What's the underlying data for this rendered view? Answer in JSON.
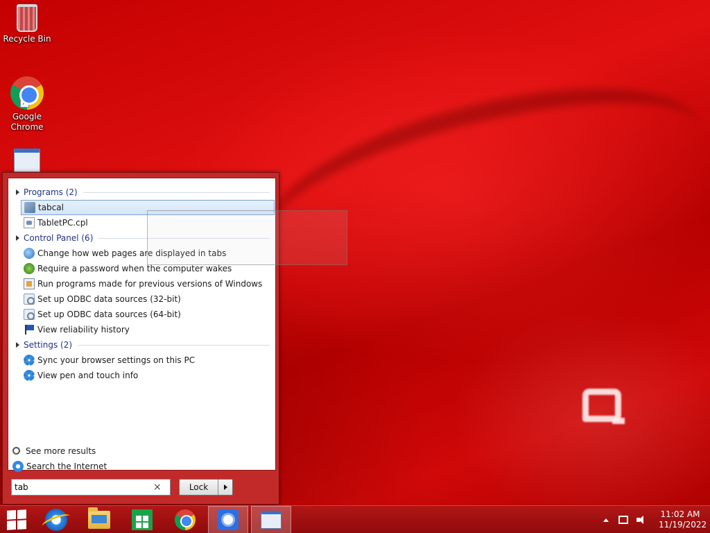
{
  "desktop": {
    "icons": [
      {
        "label": "Recycle Bin",
        "icon": "recycle-bin-icon"
      },
      {
        "label": "Google Chrome",
        "icon": "chrome-icon"
      },
      {
        "label": "",
        "icon": "control-panel-icon"
      }
    ]
  },
  "start_menu": {
    "groups": [
      {
        "header": "Programs (2)",
        "items": [
          {
            "label": "tabcal",
            "icon": "tabcal-app-icon",
            "selected": true
          },
          {
            "label": "TabletPC.cpl",
            "icon": "cpl-file-icon"
          }
        ]
      },
      {
        "header": "Control Panel (6)",
        "items": [
          {
            "label": "Change how web pages are displayed in tabs",
            "icon": "internet-options-icon"
          },
          {
            "label": "Require a password when the computer wakes",
            "icon": "power-options-icon"
          },
          {
            "label": "Run programs made for previous versions of Windows",
            "icon": "compatibility-icon"
          },
          {
            "label": "Set up ODBC data sources (32-bit)",
            "icon": "odbc-icon"
          },
          {
            "label": "Set up ODBC data sources (64-bit)",
            "icon": "odbc-icon"
          },
          {
            "label": "View reliability history",
            "icon": "action-center-flag-icon"
          }
        ]
      },
      {
        "header": "Settings (2)",
        "items": [
          {
            "label": "Sync your browser settings on this PC",
            "icon": "settings-gear-icon"
          },
          {
            "label": "View pen and touch info",
            "icon": "settings-gear-icon"
          }
        ]
      }
    ],
    "see_more": "See more results",
    "search_internet": "Search the Internet",
    "search": {
      "value": "tab",
      "clear_glyph": "×"
    },
    "power_button": {
      "label": "Lock"
    }
  },
  "taskbar": {
    "start_icon": "windows-logo-icon",
    "pinned": [
      {
        "name": "internet-explorer-icon"
      },
      {
        "name": "file-explorer-icon"
      },
      {
        "name": "store-icon"
      },
      {
        "name": "chrome-icon"
      },
      {
        "name": "brightness-app-icon",
        "active": true
      },
      {
        "name": "control-panel-icon",
        "active": true
      }
    ],
    "clock": {
      "time": "11:02 AM",
      "date": "11/19/2022"
    }
  }
}
